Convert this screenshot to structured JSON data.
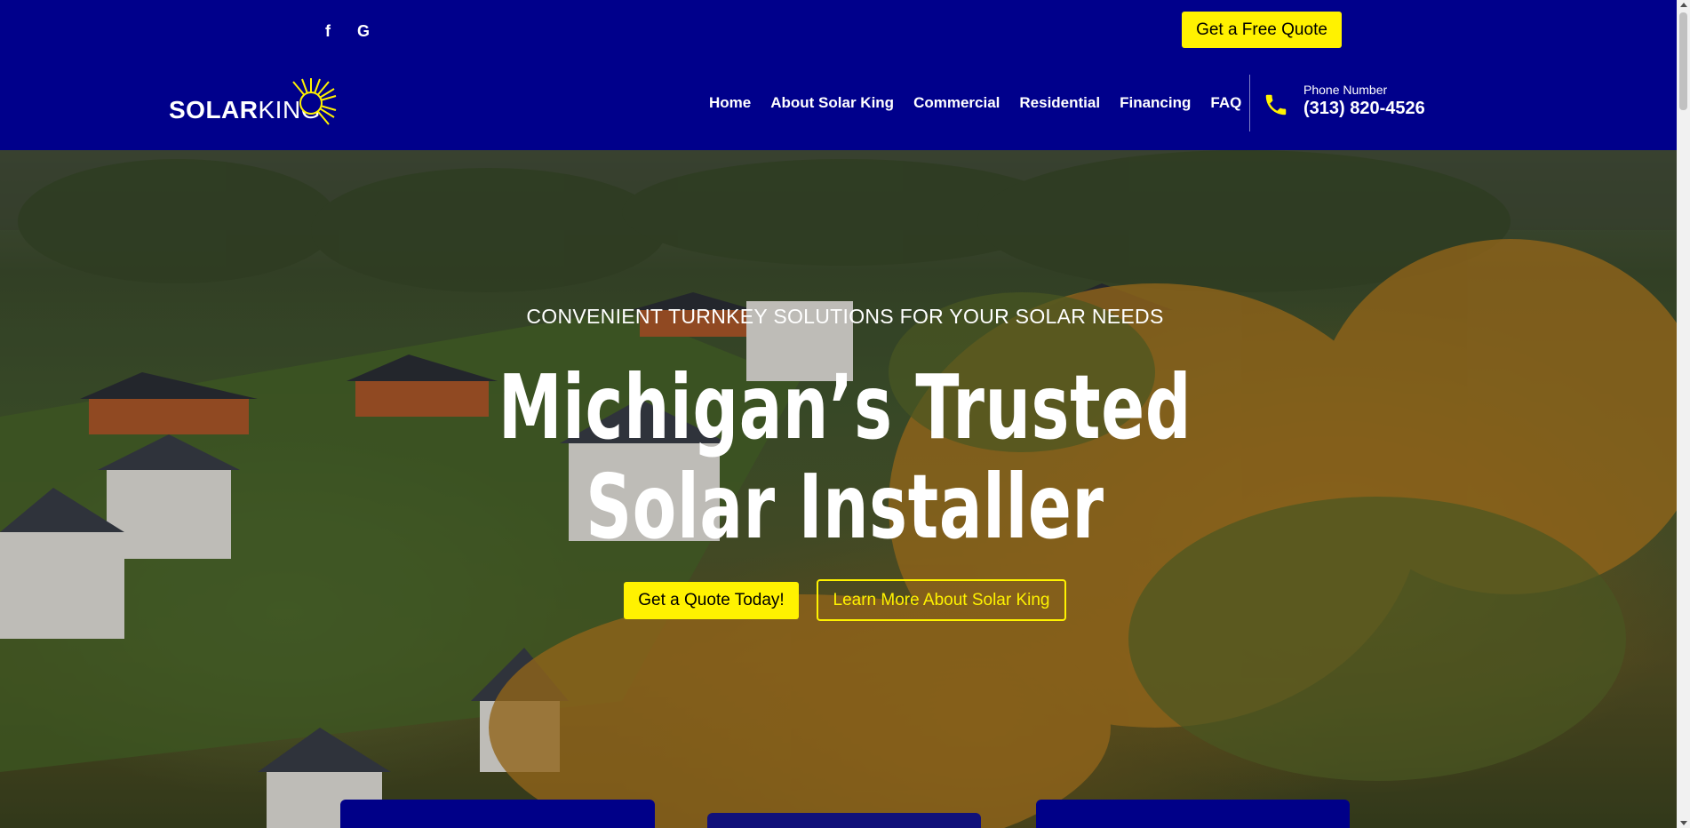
{
  "topbar": {
    "social": [
      {
        "icon": "facebook-icon",
        "glyph": "f"
      },
      {
        "icon": "google-icon",
        "glyph": "G"
      }
    ],
    "quote_button": "Get a Free Quote"
  },
  "header": {
    "logo": {
      "part1": "SOLAR",
      "part2": "KING"
    },
    "nav": [
      "Home",
      "About Solar King",
      "Commercial",
      "Residential",
      "Financing",
      "FAQ"
    ],
    "phone_label": "Phone Number",
    "phone_number": "(313) 820-4526"
  },
  "hero": {
    "tagline": "CONVENIENT TURNKEY SOLUTIONS FOR YOUR SOLAR NEEDS",
    "headline_line1": "Michigan’s Trusted",
    "headline_line2": "Solar Installer",
    "primary_button": "Get a Quote Today!",
    "secondary_button": "Learn More About Solar King"
  },
  "colors": {
    "brand_blue": "#00008b",
    "accent_yellow": "#fff200"
  }
}
